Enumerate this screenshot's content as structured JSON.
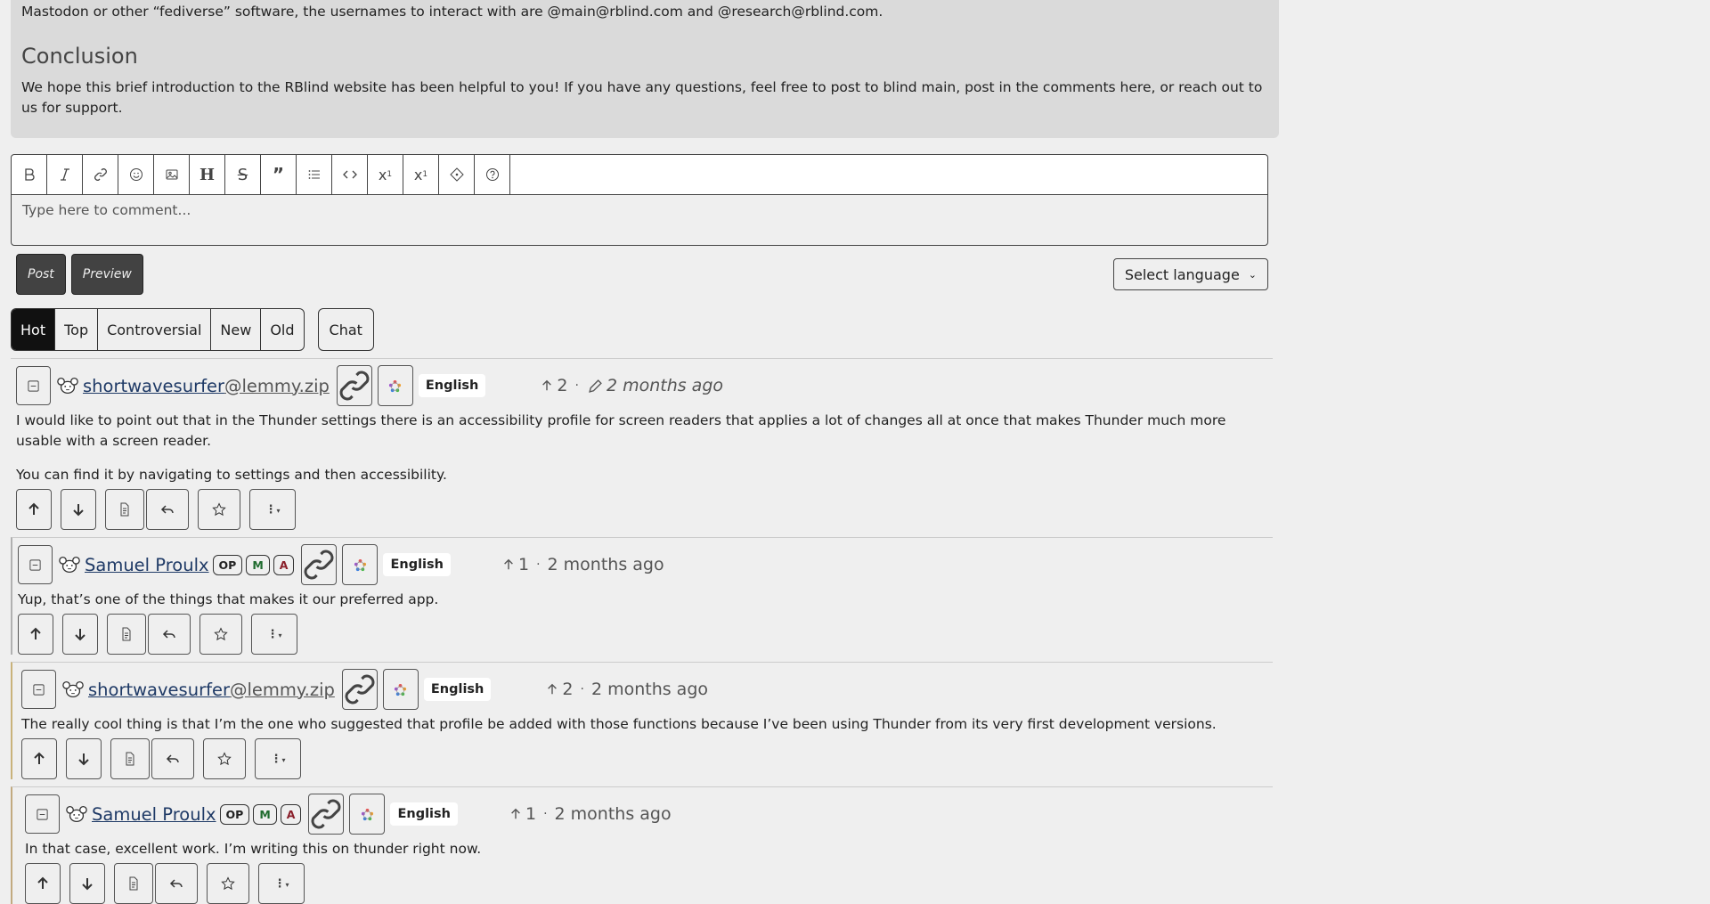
{
  "post": {
    "intro_text": "Mastodon or other “fediverse” software, the usernames to interact with are @main@rblind.com and @research@rblind.com.",
    "conclusion_heading": "Conclusion",
    "conclusion_text": "We hope this brief introduction to the RBlind website has been helpful to you! If you have any questions, feel free to post to blind main, post in the comments here, or reach out to us for support."
  },
  "editor": {
    "placeholder": "Type here to comment...",
    "toolbar": [
      "bold-icon",
      "italic-icon",
      "link-icon",
      "emoji-icon",
      "image-icon",
      "header-icon",
      "strikethrough-icon",
      "quote-icon",
      "list-icon",
      "code-icon",
      "subscript-icon",
      "superscript-icon",
      "spoiler-icon",
      "help-icon"
    ],
    "post_label": "Post",
    "preview_label": "Preview",
    "language_label": "Select language"
  },
  "sort": {
    "options": [
      "Hot",
      "Top",
      "Controversial",
      "New",
      "Old"
    ],
    "active": "Hot",
    "chat_label": "Chat"
  },
  "comments": [
    {
      "user": "shortwavesurfer",
      "instance": "@lemmy.zip",
      "badges": [],
      "language": "English",
      "score": "2",
      "edited": true,
      "time": "2 months ago",
      "paragraphs": [
        "I would like to point out that in the Thunder settings there is an accessibility profile for screen readers that applies a lot of changes all at once that makes Thunder much more usable with a screen reader.",
        "You can find it by navigating to settings and then accessibility."
      ]
    },
    {
      "user": "Samuel Proulx",
      "instance": "",
      "badges": [
        "OP",
        "M",
        "A"
      ],
      "language": "English",
      "score": "1",
      "edited": false,
      "time": "2 months ago",
      "paragraphs": [
        "Yup, that’s one of the things that makes it our preferred app."
      ]
    },
    {
      "user": "shortwavesurfer",
      "instance": "@lemmy.zip",
      "badges": [],
      "language": "English",
      "score": "2",
      "edited": false,
      "time": "2 months ago",
      "paragraphs": [
        "The really cool thing is that I’m the one who suggested that profile be added with those functions because I’ve been using Thunder from its very first development versions."
      ]
    },
    {
      "user": "Samuel Proulx",
      "instance": "",
      "badges": [
        "OP",
        "M",
        "A"
      ],
      "language": "English",
      "score": "1",
      "edited": false,
      "time": "2 months ago",
      "paragraphs": [
        "In that case, excellent work. I’m writing this on thunder right now."
      ]
    }
  ],
  "separator": "·",
  "colors": {
    "link": "#1f3a66",
    "active_sort": "#111111",
    "post_bg": "#dadada"
  }
}
